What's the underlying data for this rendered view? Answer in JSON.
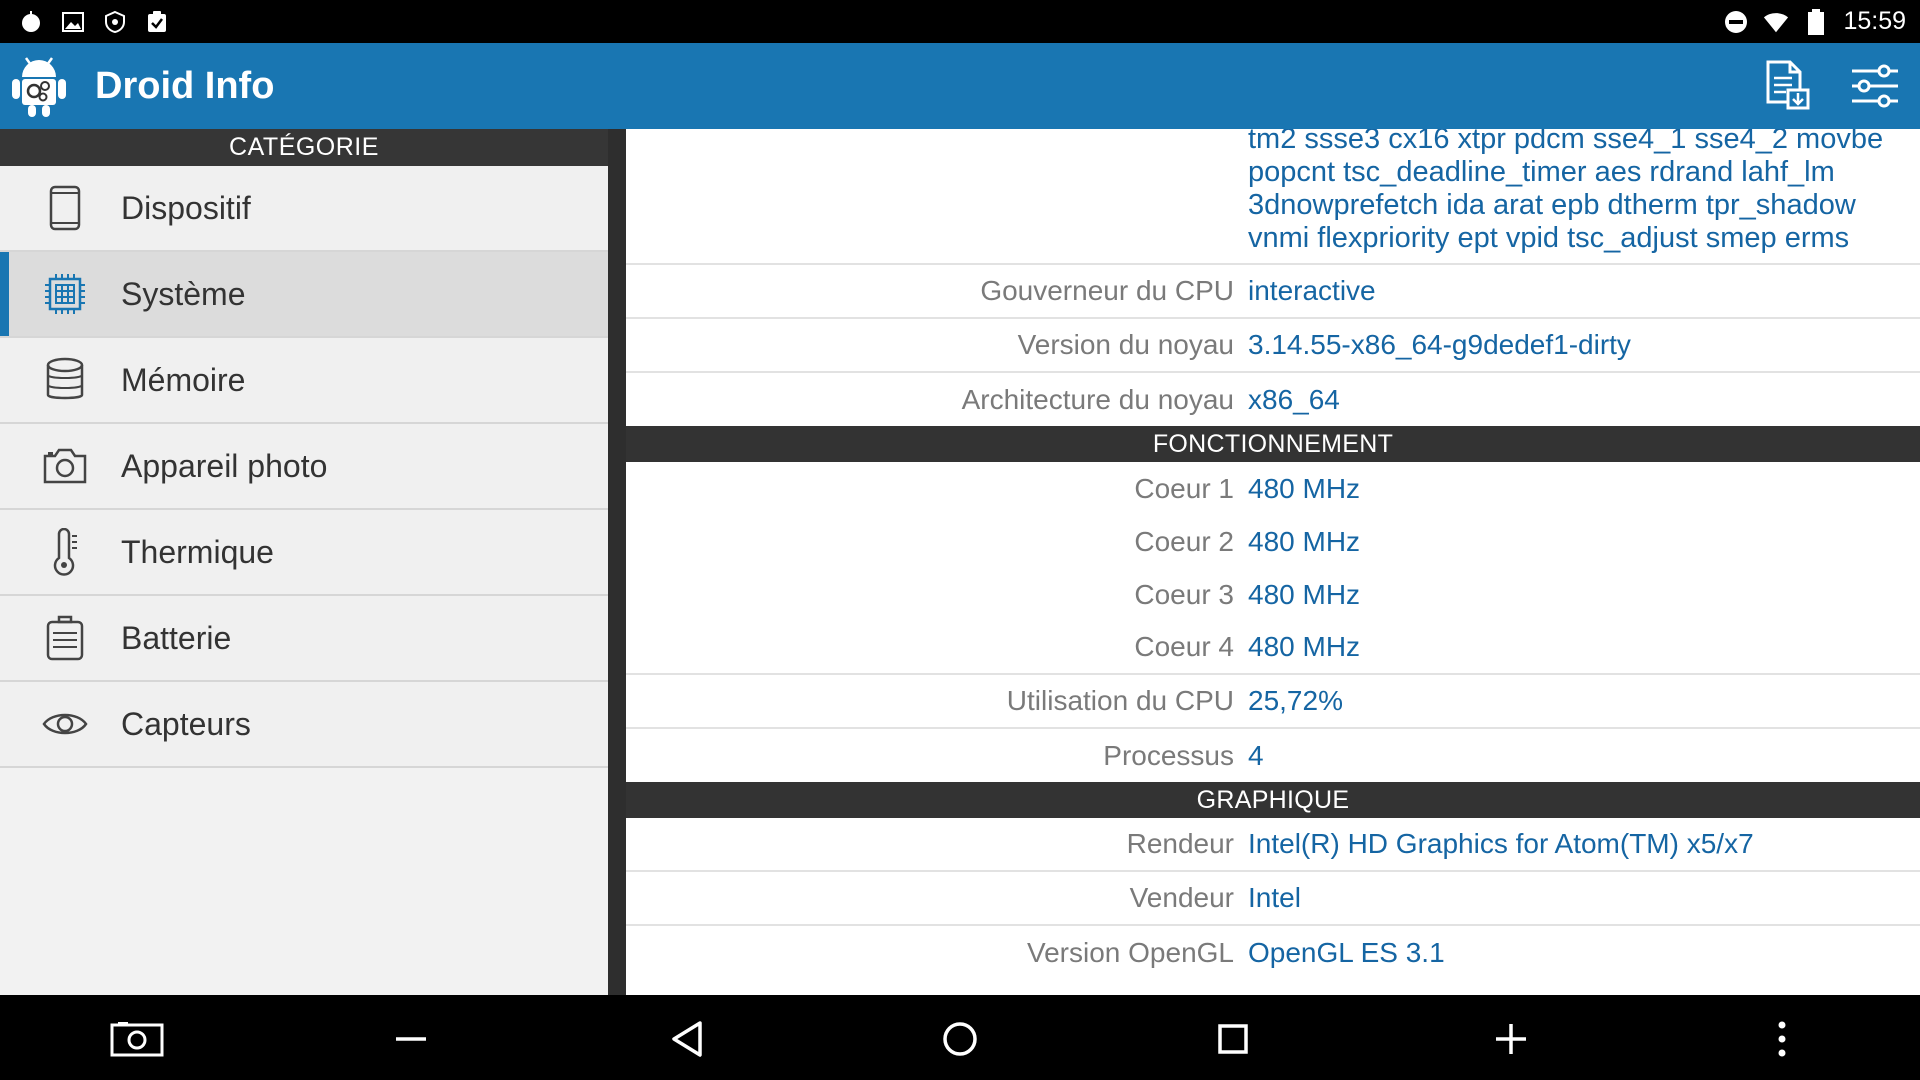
{
  "status_bar": {
    "time": "15:59",
    "left_icons": [
      "app-notification-icon",
      "image-notification-icon",
      "shield-notification-icon",
      "clipboard-check-icon"
    ],
    "right_icons": [
      "do-not-disturb-icon",
      "wifi-icon",
      "battery-icon"
    ]
  },
  "app_bar": {
    "title": "Droid Info",
    "actions": [
      "export-report-icon",
      "settings-sliders-icon"
    ]
  },
  "sidebar": {
    "header": "CATÉGORIE",
    "selected_index": 1,
    "items": [
      {
        "label": "Dispositif",
        "icon": "phone-icon"
      },
      {
        "label": "Système",
        "icon": "cpu-chip-icon"
      },
      {
        "label": "Mémoire",
        "icon": "database-icon"
      },
      {
        "label": "Appareil photo",
        "icon": "camera-icon"
      },
      {
        "label": "Thermique",
        "icon": "thermometer-icon"
      },
      {
        "label": "Batterie",
        "icon": "battery-icon"
      },
      {
        "label": "Capteurs",
        "icon": "eye-icon"
      }
    ]
  },
  "details": {
    "flags_text": "tm2 ssse3 cx16 xtpr pdcm sse4_1 sse4_2 movbe popcnt tsc_deadline_timer aes rdrand lahf_lm 3dnowprefetch ida arat epb dtherm tpr_shadow vnmi flexpriority ept vpid tsc_adjust smep erms",
    "system_rows": [
      {
        "label": "Gouverneur du CPU",
        "value": "interactive"
      },
      {
        "label": "Version du noyau",
        "value": "3.14.55-x86_64-g9dedef1-dirty"
      },
      {
        "label": "Architecture du noyau",
        "value": "x86_64"
      }
    ],
    "sections": [
      {
        "title": "FONCTIONNEMENT",
        "rows": [
          {
            "label": "Coeur 1",
            "value": "480 MHz"
          },
          {
            "label": "Coeur 2",
            "value": "480 MHz"
          },
          {
            "label": "Coeur 3",
            "value": "480 MHz"
          },
          {
            "label": "Coeur 4",
            "value": "480 MHz"
          },
          {
            "label": "Utilisation du CPU",
            "value": "25,72%"
          },
          {
            "label": "Processus",
            "value": "4"
          }
        ]
      },
      {
        "title": "GRAPHIQUE",
        "rows": [
          {
            "label": "Rendeur",
            "value": "Intel(R) HD Graphics for Atom(TM) x5/x7"
          },
          {
            "label": "Vendeur",
            "value": "Intel"
          },
          {
            "label": "Version OpenGL",
            "value": "OpenGL ES 3.1"
          }
        ]
      }
    ]
  },
  "nav_bar": {
    "buttons": [
      "screenshot-icon",
      "volume-down-icon",
      "back-icon",
      "home-icon",
      "recents-icon",
      "volume-up-icon",
      "more-icon"
    ]
  },
  "colors": {
    "accent": "#1976b2",
    "value_text": "#1565a3",
    "label_text": "#7a7a7a",
    "section_header": "#333333"
  }
}
